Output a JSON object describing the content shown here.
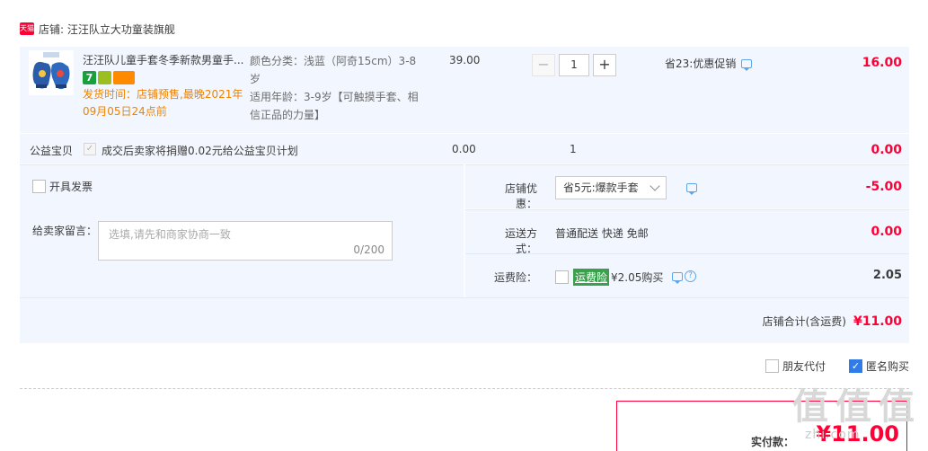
{
  "store": {
    "badge_text": "天猫",
    "label": "店铺: 汪汪队立大功童装旗舰"
  },
  "item": {
    "title": "汪汪队儿童手套冬季新款男童手...",
    "badge_seven": "7",
    "ship_note": "发货时间：店铺预售,最晚2021年09月05日24点前",
    "attr_color": "颜色分类：浅蓝（阿奇15cm）3-8岁",
    "attr_age": "适用年龄：3-9岁【可触摸手套、相信正品的力量】",
    "price": "39.00",
    "minus": "−",
    "plus": "+",
    "qty": "1",
    "promo": "省23:优惠促销",
    "subtotal": "16.00"
  },
  "charity": {
    "label": "公益宝贝",
    "check_mark": "✓",
    "text": "成交后卖家将捐赠0.02元给公益宝贝计划",
    "price": "0.00",
    "qty": "1",
    "subtotal": "0.00"
  },
  "invoice": {
    "label": "开具发票"
  },
  "message": {
    "label": "给卖家留言：",
    "placeholder": "选填,请先和商家协商一致",
    "count": "0/200"
  },
  "discount": {
    "label": "店铺优惠：",
    "selected": "省5元:爆款手套",
    "amount": "-5.00"
  },
  "shipping": {
    "label": "运送方式：",
    "value": "普通配送 快递 免邮",
    "amount": "0.00"
  },
  "insurance": {
    "label": "运费险：",
    "tag": "运费险",
    "text": "¥2.05购买",
    "help": "?",
    "amount": "2.05"
  },
  "store_total": {
    "label": "店铺合计(含运费)",
    "amount": "¥11.00"
  },
  "options": {
    "friend_pay": "朋友代付",
    "anonymous": "匿名购买",
    "anonymous_checked": true,
    "check_mark": "✓"
  },
  "payment": {
    "label": "实付款：",
    "amount": "¥11.00"
  },
  "watermark": {
    "glyphs": [
      "值",
      "值",
      "值"
    ],
    "site": "zhi.com"
  },
  "colors": {
    "accent_red": "#ff0036",
    "row_blue": "#f2f7ff",
    "link_blue": "#2f7be8",
    "ship_orange": "#f08200"
  }
}
